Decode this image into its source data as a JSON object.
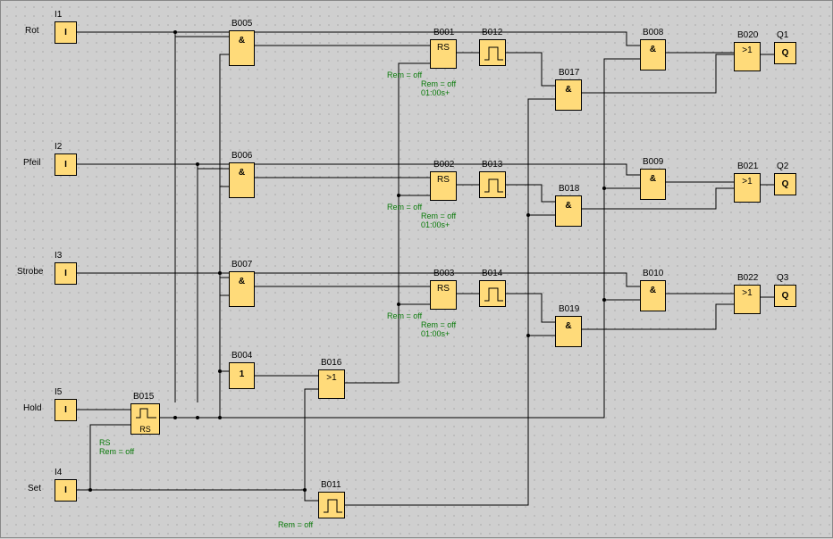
{
  "inputs": {
    "I1": {
      "id": "I1",
      "name": "Rot",
      "sym": "I"
    },
    "I2": {
      "id": "I2",
      "name": "Pfeil",
      "sym": "I"
    },
    "I3": {
      "id": "I3",
      "name": "Strobe",
      "sym": "I"
    },
    "I4": {
      "id": "I4",
      "name": "Set",
      "sym": "I"
    },
    "I5": {
      "id": "I5",
      "name": "Hold",
      "sym": "I"
    }
  },
  "outputs": {
    "Q1": {
      "id": "Q1",
      "sym": "Q"
    },
    "Q2": {
      "id": "Q2",
      "sym": "Q"
    },
    "Q3": {
      "id": "Q3",
      "sym": "Q"
    }
  },
  "blocks": {
    "B001": {
      "sym": "RS"
    },
    "B002": {
      "sym": "RS"
    },
    "B003": {
      "sym": "RS"
    },
    "B004": {
      "sym": "1"
    },
    "B005": {
      "sym": "&"
    },
    "B006": {
      "sym": "&"
    },
    "B007": {
      "sym": "&"
    },
    "B008": {
      "sym": "&"
    },
    "B009": {
      "sym": "&"
    },
    "B010": {
      "sym": "&"
    },
    "B011": {
      "sym": "PULSE"
    },
    "B012": {
      "sym": "PULSE"
    },
    "B013": {
      "sym": "PULSE"
    },
    "B014": {
      "sym": "PULSE"
    },
    "B015": {
      "note": "RS",
      "rem": "Rem = off",
      "sym": "RS"
    },
    "B016": {
      "sym": ">1"
    },
    "B017": {
      "sym": "&"
    },
    "B018": {
      "sym": "&"
    },
    "B019": {
      "sym": "&"
    },
    "B020": {
      "sym": ">1"
    },
    "B021": {
      "sym": ">1"
    },
    "B022": {
      "sym": ">1"
    }
  },
  "notes": {
    "rem_off": "Rem = off",
    "rem_off_time": "Rem = off\n01:00s+"
  },
  "block_ids": {
    "B001": "B001",
    "B002": "B002",
    "B003": "B003",
    "B004": "B004",
    "B005": "B005",
    "B006": "B006",
    "B007": "B007",
    "B008": "B008",
    "B009": "B009",
    "B010": "B010",
    "B011": "B011",
    "B012": "B012",
    "B013": "B013",
    "B014": "B014",
    "B015": "B015",
    "B016": "B016",
    "B017": "B017",
    "B018": "B018",
    "B019": "B019",
    "B020": "B020",
    "B021": "B021",
    "B022": "B022"
  },
  "chart_data": {
    "type": "diagram",
    "nodes": [
      {
        "id": "I1",
        "type": "input",
        "label": "Rot"
      },
      {
        "id": "I2",
        "type": "input",
        "label": "Pfeil"
      },
      {
        "id": "I3",
        "type": "input",
        "label": "Strobe"
      },
      {
        "id": "I4",
        "type": "input",
        "label": "Set"
      },
      {
        "id": "I5",
        "type": "input",
        "label": "Hold"
      },
      {
        "id": "B005",
        "type": "AND"
      },
      {
        "id": "B006",
        "type": "AND"
      },
      {
        "id": "B007",
        "type": "AND"
      },
      {
        "id": "B001",
        "type": "RS",
        "note": "Rem=off, 01:00s+"
      },
      {
        "id": "B002",
        "type": "RS",
        "note": "Rem=off, 01:00s+"
      },
      {
        "id": "B003",
        "type": "RS",
        "note": "Rem=off, 01:00s+"
      },
      {
        "id": "B012",
        "type": "pulse"
      },
      {
        "id": "B013",
        "type": "pulse"
      },
      {
        "id": "B014",
        "type": "pulse"
      },
      {
        "id": "B004",
        "type": "NOT"
      },
      {
        "id": "B016",
        "type": "OR"
      },
      {
        "id": "B015",
        "type": "RS",
        "note": "Rem=off"
      },
      {
        "id": "B011",
        "type": "pulse",
        "note": "Rem=off"
      },
      {
        "id": "B017",
        "type": "AND"
      },
      {
        "id": "B018",
        "type": "AND"
      },
      {
        "id": "B019",
        "type": "AND"
      },
      {
        "id": "B008",
        "type": "AND"
      },
      {
        "id": "B009",
        "type": "AND"
      },
      {
        "id": "B010",
        "type": "AND"
      },
      {
        "id": "B020",
        "type": "OR"
      },
      {
        "id": "B021",
        "type": "OR"
      },
      {
        "id": "B022",
        "type": "OR"
      },
      {
        "id": "Q1",
        "type": "output"
      },
      {
        "id": "Q2",
        "type": "output"
      },
      {
        "id": "Q3",
        "type": "output"
      }
    ],
    "edges": [
      [
        "I1",
        "B005"
      ],
      [
        "I1",
        "B008"
      ],
      [
        "I2",
        "B006"
      ],
      [
        "I2",
        "B009"
      ],
      [
        "I3",
        "B007"
      ],
      [
        "I3",
        "B010"
      ],
      [
        "I5",
        "B015.S"
      ],
      [
        "I4",
        "B015.R"
      ],
      [
        "B015",
        "B005"
      ],
      [
        "B015",
        "B006"
      ],
      [
        "B015",
        "B007"
      ],
      [
        "B015",
        "B004"
      ],
      [
        "B004",
        "B016"
      ],
      [
        "I4",
        "B016"
      ],
      [
        "B005",
        "B001.S"
      ],
      [
        "B016",
        "B001.R"
      ],
      [
        "B006",
        "B002.S"
      ],
      [
        "B016",
        "B002.R"
      ],
      [
        "B007",
        "B003.S"
      ],
      [
        "B016",
        "B003.R"
      ],
      [
        "B001",
        "B012"
      ],
      [
        "B002",
        "B013"
      ],
      [
        "B003",
        "B014"
      ],
      [
        "I4",
        "B011"
      ],
      [
        "B012",
        "B017"
      ],
      [
        "B013",
        "B018"
      ],
      [
        "B014",
        "B019"
      ],
      [
        "B011",
        "B017"
      ],
      [
        "B011",
        "B018"
      ],
      [
        "B011",
        "B019"
      ],
      [
        "B015",
        "B008"
      ],
      [
        "B015",
        "B009"
      ],
      [
        "B015",
        "B010"
      ],
      [
        "B017",
        "B020"
      ],
      [
        "B008",
        "B020"
      ],
      [
        "B018",
        "B021"
      ],
      [
        "B009",
        "B021"
      ],
      [
        "B019",
        "B022"
      ],
      [
        "B010",
        "B022"
      ],
      [
        "B020",
        "Q1"
      ],
      [
        "B021",
        "Q2"
      ],
      [
        "B022",
        "Q3"
      ]
    ]
  }
}
